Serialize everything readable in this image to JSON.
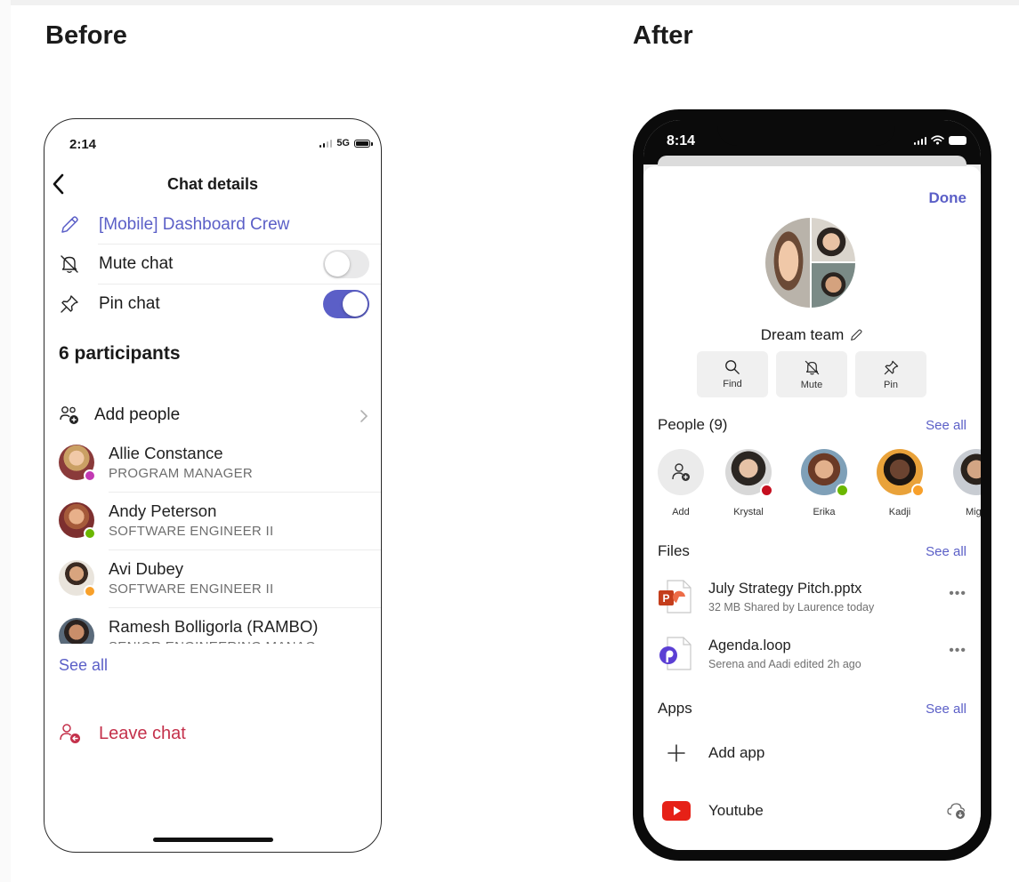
{
  "before": {
    "heading": "Before",
    "status": {
      "time": "2:14",
      "network": "5G"
    },
    "header": {
      "title": "Chat details"
    },
    "chat_name": "[Mobile] Dashboard Crew",
    "settings": [
      {
        "label": "Mute chat",
        "icon": "bell-off-icon",
        "toggle": false
      },
      {
        "label": "Pin chat",
        "icon": "pin-icon",
        "toggle": true
      }
    ],
    "participants_heading": "6 participants",
    "add_people": "Add people",
    "participants": [
      {
        "name": "Allie Constance",
        "role": "PROGRAM MANAGER",
        "presence": "#c239b3"
      },
      {
        "name": "Andy Peterson",
        "role": "SOFTWARE ENGINEER II",
        "presence": "#6bb700"
      },
      {
        "name": "Avi Dubey",
        "role": "SOFTWARE ENGINEER II",
        "presence": "#f8a02a"
      },
      {
        "name": "Ramesh Bolligorla (RAMBO)",
        "role": "SENIOR ENGINEERING MANAG",
        "presence": ""
      }
    ],
    "see_all": "See all",
    "leave_chat": "Leave chat",
    "colors": {
      "accent": "#5b5fc7",
      "danger": "#c4314b"
    }
  },
  "after": {
    "heading": "After",
    "status": {
      "time": "8:14"
    },
    "done": "Done",
    "group_name": "Dream team",
    "actions": [
      {
        "label": "Find",
        "icon": "search-icon"
      },
      {
        "label": "Mute",
        "icon": "bell-off-icon"
      },
      {
        "label": "Pin",
        "icon": "pin-icon"
      }
    ],
    "people": {
      "title": "People (9)",
      "see_all": "See all",
      "add_label": "Add",
      "items": [
        {
          "name": "Krystal",
          "presence": "#c50f1f"
        },
        {
          "name": "Erika",
          "presence": "#6bb700"
        },
        {
          "name": "Kadji",
          "presence": "#f8a02a"
        },
        {
          "name": "Migu",
          "presence": ""
        }
      ]
    },
    "files": {
      "title": "Files",
      "see_all": "See all",
      "items": [
        {
          "name": "July Strategy Pitch.pptx",
          "meta": "32 MB Shared by Laurence today",
          "icon": "powerpoint-icon",
          "more": "•••"
        },
        {
          "name": "Agenda.loop",
          "meta": "Serena and Aadi edited 2h ago",
          "icon": "loop-icon",
          "more": "•••"
        }
      ]
    },
    "apps": {
      "title": "Apps",
      "see_all": "See all",
      "items": [
        {
          "name": "Add app",
          "icon": "plus-icon"
        },
        {
          "name": "Youtube",
          "icon": "youtube-icon"
        }
      ]
    }
  }
}
